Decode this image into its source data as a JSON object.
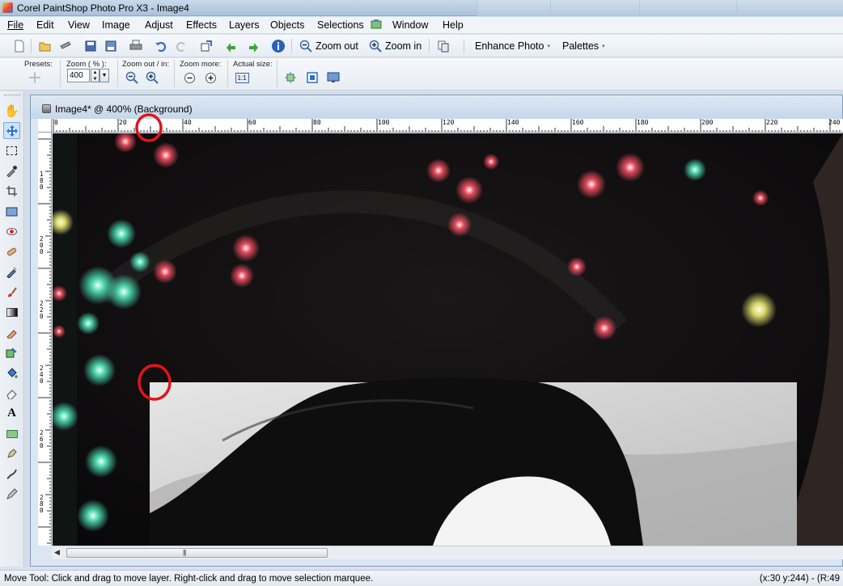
{
  "window": {
    "title": "Corel PaintShop Photo Pro X3 - Image4"
  },
  "menubar": {
    "items": [
      "File",
      "Edit",
      "View",
      "Image",
      "Adjust",
      "Effects",
      "Layers",
      "Objects",
      "Selections",
      "Window",
      "Help"
    ]
  },
  "toolbar": {
    "zoom_out_label": "Zoom out",
    "zoom_in_label": "Zoom in",
    "enhance_photo_label": "Enhance Photo",
    "palettes_label": "Palettes"
  },
  "tool_options": {
    "presets_label": "Presets:",
    "zoom_label": "Zoom ( % ):",
    "zoom_value": "400",
    "zoom_out_in_label": "Zoom out / in:",
    "zoom_more_label": "Zoom more:",
    "actual_size_label": "Actual size:",
    "actual_size_button": "1:1"
  },
  "image_window": {
    "title": "Image4* @ 400% (Background)"
  },
  "rulers": {
    "top_labels": [
      "0",
      "20",
      "40",
      "60",
      "80",
      "100",
      "120",
      "140",
      "160",
      "180",
      "200",
      "220",
      "240"
    ],
    "left_labels": [
      "1\n8\n0",
      "2\n0\n0",
      "2\n2\n0",
      "2\n4\n0",
      "2\n6\n0",
      "2\n8\n0"
    ]
  },
  "statusbar": {
    "message": "Move Tool: Click and drag to move layer. Right-click and drag to move selection marquee.",
    "coords": "(x:30 y:244) - (R:49"
  },
  "colors": {
    "annotation_circle": "#e0141b",
    "canvas_background": "#0d0c0e"
  }
}
